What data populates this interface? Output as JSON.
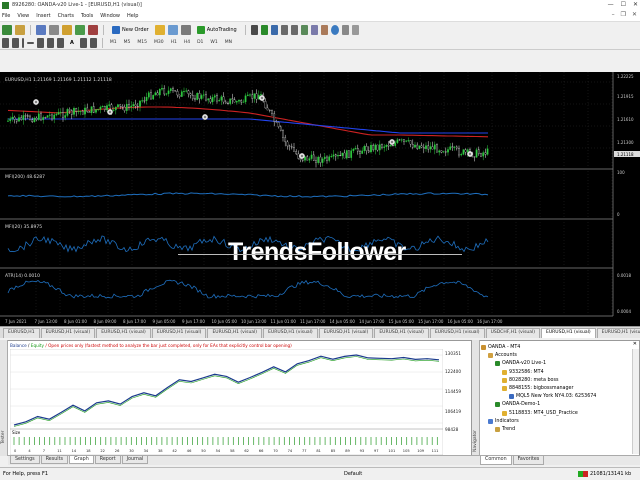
{
  "window": {
    "title": "8926280: OANDA-v20 Live-1 - [EURUSD,H1 (visual)]"
  },
  "menu": [
    "File",
    "View",
    "Insert",
    "Charts",
    "Tools",
    "Window",
    "Help"
  ],
  "toolbar": {
    "new_order": "New Order",
    "autotrading": "AutoTrading",
    "timeframes": [
      "M1",
      "M5",
      "M15",
      "M30",
      "H1",
      "H4",
      "D1",
      "W1",
      "MN"
    ]
  },
  "chart": {
    "symbol_info": "EURUSD,H1  1.21169 1.21169 1.21112 1.21118",
    "mfi1_label": "MFI(200) 48.6287",
    "mfi2_label": "MFI(20) 35.8975",
    "atr_label": "ATR(14) 0.0010",
    "price_ticks": [
      "1.22225",
      "1.21915",
      "1.21610",
      "1.21300",
      "1.21118"
    ],
    "mfi_ticks": [
      "100",
      "0"
    ],
    "atr_ticks": [
      "0.0018",
      "0.0004"
    ],
    "time_ticks": [
      "7 Jun 2021",
      "7 Jun 13:00",
      "8 Jun 01:00",
      "8 Jun 09:00",
      "8 Jun 17:00",
      "9 Jun 05:00",
      "9 Jun 17:00",
      "10 Jun 05:00",
      "10 Jun 13:00",
      "11 Jun 01:00",
      "11 Jun 17:00",
      "14 Jun 05:00",
      "14 Jun 17:00",
      "15 Jun 05:00",
      "15 Jun 17:00",
      "16 Jun 05:00",
      "16 Jun 17:00"
    ],
    "watermark": "TrendsFollower",
    "colors": {
      "background": "#000000",
      "bull": "#2ecc40",
      "ma_red": "#cc2222",
      "ma_blue": "#2244ee",
      "indicator": "#1e6fbf"
    }
  },
  "chart_tabs": [
    "EURUSD,H1",
    "EURUSD,H1 (visual)",
    "EURUSD,H1 (visual)",
    "EURUSD,H1 (visual)",
    "EURUSD,H1 (visual)",
    "EURUSD,H1 (visual)",
    "EURUSD,H1 (visual)",
    "EURUSD,H1 (visual)",
    "EURUSD,H1 (visual)",
    "USDCHF,H1 (visual)",
    "EURUSD,H1 (visual)",
    "EURUSD,H1 (visual)"
  ],
  "tester": {
    "balance_label": "Balance",
    "equity_label": "Equity",
    "model_info": "/ Open prices only (fastest method to analyze the bar just completed, only for EAs that explicitly control bar opening)",
    "y_ticks": [
      "130351",
      "122400",
      "114459",
      "106419",
      "98428"
    ],
    "size_label": "Size",
    "side_label": "Tester",
    "tabs": [
      "Settings",
      "Results",
      "Graph",
      "Report",
      "Journal"
    ],
    "active_tab": "Graph",
    "x_ticks": [
      "0",
      "4",
      "7",
      "11",
      "14",
      "18",
      "22",
      "26",
      "30",
      "34",
      "38",
      "42",
      "46",
      "50",
      "54",
      "58",
      "62",
      "66",
      "70",
      "74",
      "77",
      "81",
      "85",
      "89",
      "93",
      "97",
      "101",
      "105",
      "109",
      "111"
    ],
    "balance_curve": [
      97500,
      99000,
      101500,
      100200,
      103400,
      106800,
      104100,
      107900,
      108800,
      107300,
      110800,
      112600,
      111200,
      115100,
      118700,
      117900,
      119600,
      121300,
      120300,
      117600,
      119800,
      122200,
      124800,
      122400,
      126200,
      127700,
      129800,
      128400,
      129700,
      130351,
      129000,
      128800,
      128600,
      129200,
      128300,
      128600,
      128100
    ],
    "colors": {
      "balance": "#1a3a8c",
      "equity": "#1a9a1a",
      "size_bar": "#2a9a2a"
    }
  },
  "navigator": {
    "title": "Navigator",
    "side_label": "Navigator",
    "tree": [
      {
        "label": "OANDA - MT4",
        "level": 0
      },
      {
        "label": "Accounts",
        "level": 1
      },
      {
        "label": "OANDA-v20 Live-1",
        "level": 2
      },
      {
        "label": "9332586: MT4",
        "level": 3
      },
      {
        "label": "8028280: meta boss",
        "level": 3
      },
      {
        "label": "8848155: bigbossmanager",
        "level": 3
      },
      {
        "label": "MQL5 New York NY4.03: 6253674",
        "level": 4
      },
      {
        "label": "OANDA-Demo-1",
        "level": 2
      },
      {
        "label": "5118833: MT4_USD_Practice",
        "level": 3
      },
      {
        "label": "Indicators",
        "level": 1
      },
      {
        "label": "Trend",
        "level": 2
      }
    ],
    "tabs": [
      "Common",
      "Favorites"
    ],
    "active_tab": "Common"
  },
  "status": {
    "help": "For Help, press F1",
    "profile": "Default",
    "traffic": "21081/13141 kb"
  }
}
